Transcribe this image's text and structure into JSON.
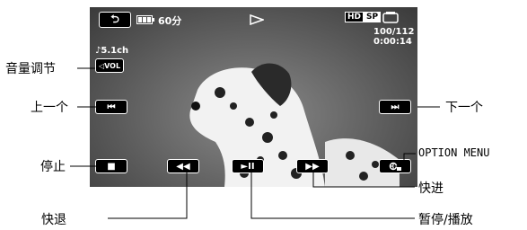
{
  "screen": {
    "battery_time": "60分",
    "format_badge_hd": "HD",
    "format_badge_sp": "SP",
    "counter": "100/112",
    "timecode": "0:00:14",
    "audio_mode": "♪5.1ch",
    "vol_label": "VOL"
  },
  "buttons": {
    "back": "⮌",
    "prev": "⏮",
    "next": "⏭",
    "stop": "■",
    "rewind": "◀◀",
    "play_pause": "►II",
    "forward": "▶▶"
  },
  "callouts": {
    "volume": "音量调节",
    "prev": "上一个",
    "next": "下一个",
    "stop": "停止",
    "option": "OPTION MENU",
    "forward": "快进",
    "rewind": "快退",
    "play_pause": "暂停/播放"
  }
}
